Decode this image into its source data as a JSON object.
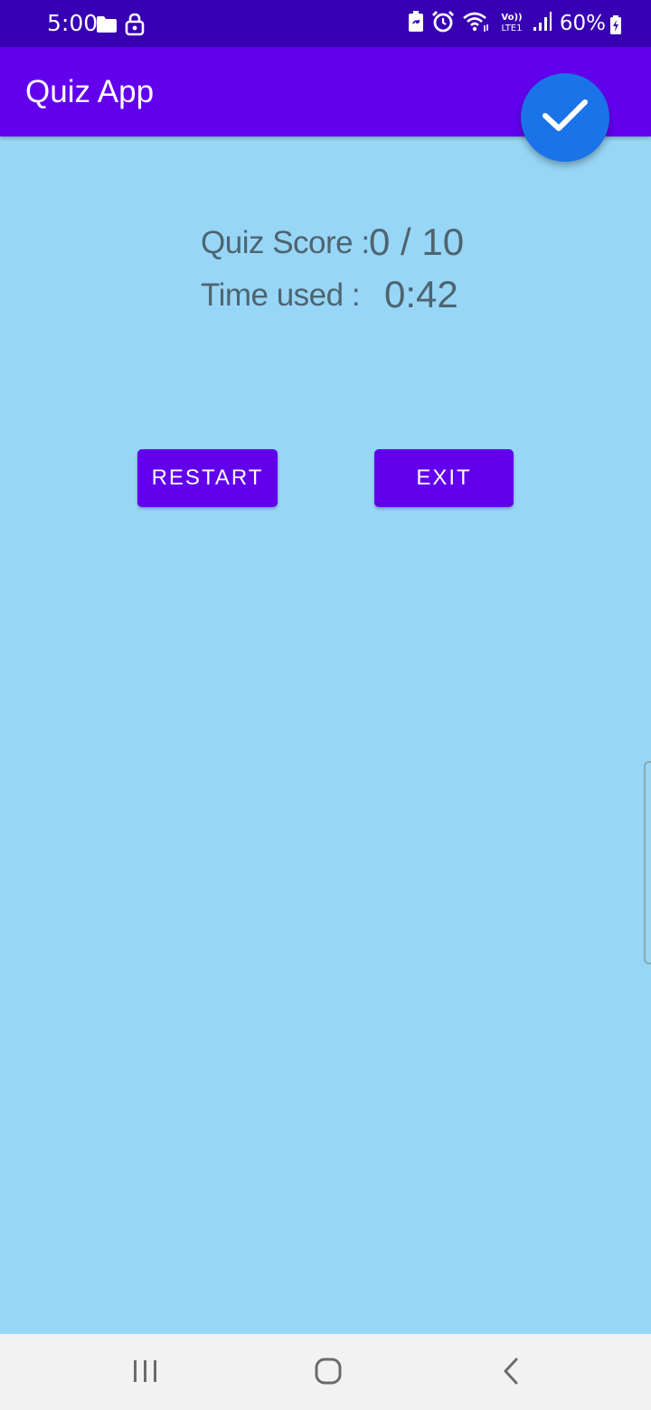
{
  "status_bar": {
    "time": "5:00",
    "battery": "60%",
    "icons": [
      "folder-icon",
      "lock-icon",
      "battery-saver-icon",
      "alarm-icon",
      "wifi-icon",
      "volte-icon",
      "signal-icon",
      "battery-icon"
    ]
  },
  "app_bar": {
    "title": "Quiz App"
  },
  "fab": {
    "icon": "check-icon",
    "color": "#1a73e8"
  },
  "result": {
    "score_label": "Quiz Score :",
    "score_value": "0 / 10",
    "time_label": "Time used :",
    "time_value": "0:42"
  },
  "buttons": {
    "restart": "RESTART",
    "exit": "EXIT"
  },
  "colors": {
    "status_bar": "#3700b3",
    "app_bar": "#6200ee",
    "background": "#97d6f6",
    "button": "#6200ee",
    "text": "#4e6470"
  },
  "nav_bar": {
    "icons": [
      "recents-icon",
      "home-icon",
      "back-icon"
    ]
  }
}
